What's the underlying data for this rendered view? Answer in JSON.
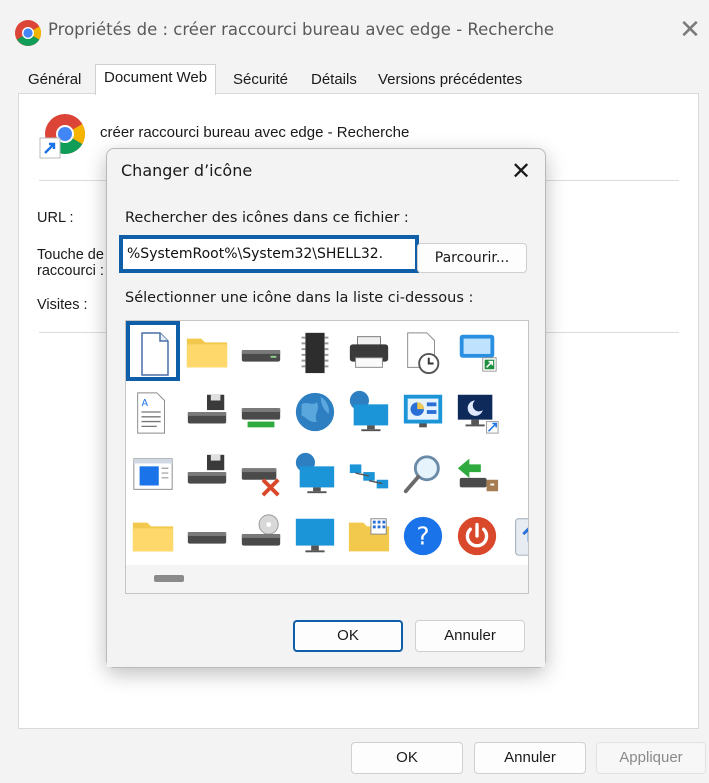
{
  "window": {
    "title": "Propriétés de : créer raccourci bureau avec edge - Recherche",
    "close_glyph": "✕"
  },
  "tabs": [
    {
      "label": "Général",
      "active": false
    },
    {
      "label": "Document Web",
      "active": true
    },
    {
      "label": "Sécurité",
      "active": false
    },
    {
      "label": "Détails",
      "active": false
    },
    {
      "label": "Versions précédentes",
      "active": false
    }
  ],
  "web_document": {
    "name": "créer raccourci bureau avec edge - Recherche",
    "url_label": "URL :",
    "shortcut_key_label_line1": "Touche de",
    "shortcut_key_label_line2": "raccourci :",
    "visits_label": "Visites :"
  },
  "bottom_buttons": {
    "ok": "OK",
    "cancel": "Annuler",
    "apply": "Appliquer"
  },
  "change_icon_dialog": {
    "title": "Changer d’icône",
    "close_glyph": "✕",
    "search_label": "Rechercher des icônes dans ce fichier :",
    "file_path": "%SystemRoot%\\System32\\SHELL32.",
    "browse_label": "Parcourir...",
    "list_label": "Sélectionner une icône dans la liste ci-dessous :",
    "ok_label": "OK",
    "cancel_label": "Annuler",
    "selected_index": 0,
    "icons": [
      "blank-document-icon",
      "folder-icon",
      "drive-icon",
      "memory-chip-icon",
      "printer-icon",
      "clock-document-icon",
      "window-shortcut-icon",
      "text-document-icon",
      "floppy-drive-icon",
      "green-drive-icon",
      "globe-icon",
      "network-monitor-icon",
      "control-panel-icon",
      "sleep-monitor-icon",
      "application-window-icon",
      "floppy-drive-alt-icon",
      "disconnected-drive-icon",
      "globe-monitor-icon",
      "network-icon",
      "magnifier-icon",
      "transfer-drive-icon",
      "folder-alt-icon",
      "drive-alt-icon",
      "cd-drive-icon",
      "monitor-icon",
      "folder-grid-icon",
      "help-icon",
      "power-icon"
    ]
  },
  "colors": {
    "accent": "#0f5ea8",
    "window_bg": "#f3f3f3",
    "panel_bg": "#ffffff"
  }
}
